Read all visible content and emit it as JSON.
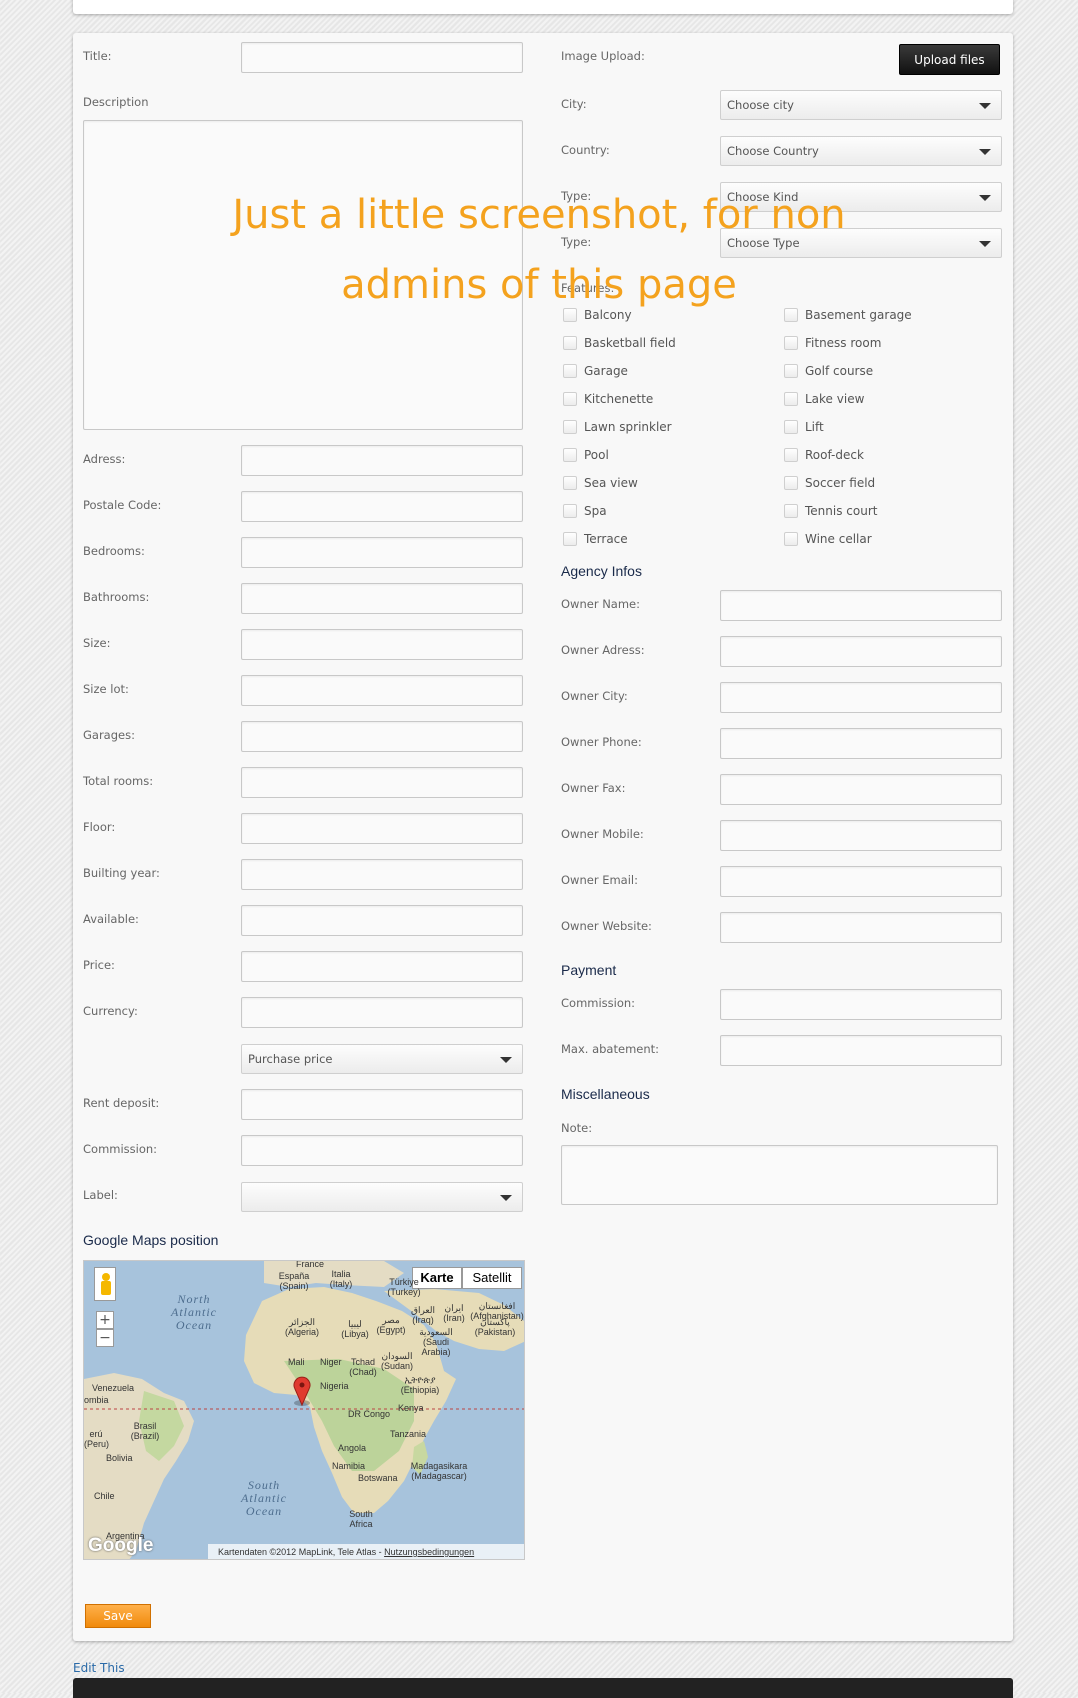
{
  "left_fields": {
    "title": "Title:",
    "description": "Description",
    "adress": "Adress:",
    "postal_code": "Postale Code:",
    "bedrooms": "Bedrooms:",
    "bathrooms": "Bathrooms:",
    "size": "Size:",
    "size_lot": "Size lot:",
    "garages": "Garages:",
    "total_rooms": "Total rooms:",
    "floor": "Floor:",
    "building_year": "Builting year:",
    "available": "Available:",
    "price": "Price:",
    "currency": "Currency:",
    "price_type_select": "Purchase price",
    "rent_deposit": "Rent deposit:",
    "commission": "Commission:",
    "label": "Label:",
    "label_select": ""
  },
  "right_fields": {
    "image_upload": "Image Upload:",
    "upload_button": "Upload files",
    "city": "City:",
    "city_select": "Choose city",
    "country": "Country:",
    "country_select": "Choose Country",
    "type_kind": "Type:",
    "kind_select": "Choose Kind",
    "type": "Type:",
    "type_select": "Choose Type",
    "features": "Features:"
  },
  "features": [
    "Balcony",
    "Basement garage",
    "Basketball field",
    "Fitness room",
    "Garage",
    "Golf course",
    "Kitchenette",
    "Lake view",
    "Lawn sprinkler",
    "Lift",
    "Pool",
    "Roof-deck",
    "Sea view",
    "Soccer field",
    "Spa",
    "Tennis court",
    "Terrace",
    "Wine cellar"
  ],
  "agency": {
    "title": "Agency Infos",
    "owner_name": "Owner Name:",
    "owner_adress": "Owner Adress:",
    "owner_city": "Owner City:",
    "owner_phone": "Owner Phone:",
    "owner_fax": "Owner Fax:",
    "owner_mobile": "Owner Mobile:",
    "owner_email": "Owner Email:",
    "owner_website": "Owner Website:"
  },
  "payment": {
    "title": "Payment",
    "commission": "Commission:",
    "max_abatement": "Max. abatement:"
  },
  "misc": {
    "title": "Miscellaneous",
    "note": "Note:"
  },
  "map": {
    "title": "Google Maps position",
    "btn_map": "Karte",
    "btn_satellite": "Satellit",
    "copyright": "Kartendaten ©2012 MapLink, Tele Atlas -",
    "terms": "Nutzungsbedingungen",
    "logo": "Google",
    "oceans": [
      "North Atlantic Ocean",
      "South Atlantic Ocean"
    ],
    "places": [
      "France",
      "España (Spain)",
      "Italia (Italy)",
      "Türkiye (Turkey)",
      "الجزائر (Algeria)",
      "ليبيا (Libya)",
      "مصر (Egypt)",
      "العراق (Iraq)",
      "ايران (Iran)",
      "افغانستان (Afghanistan)",
      "پاکستان (Pakistan)",
      "السعودية (Saudi Arabia)",
      "Mali",
      "Niger",
      "Tchad (Chad)",
      "السودان (Sudan)",
      "Nigeria",
      "ኢትዮጵያ (Ethiopia)",
      "Venezuela",
      "ombia",
      "DR Congo",
      "Kenya",
      "Tanzania",
      "erú (Peru)",
      "Brasil (Brazil)",
      "Bolivia",
      "Angola",
      "Namibia",
      "Botswana",
      "Madagasikara (Madagascar)",
      "Chile",
      "South Africa",
      "Argentina"
    ]
  },
  "overlay": {
    "line1": "Just a little screenshot, for non",
    "line2": "admins of this page"
  },
  "actions": {
    "save": "Save",
    "edit_this": "Edit This"
  },
  "colors": {
    "accent_orange": "#f4a21e",
    "save_orange": "#f39419",
    "heading_navy": "#1a2a4a",
    "link_blue": "#2a6aa8",
    "upload_black": "#1a1a1a"
  }
}
